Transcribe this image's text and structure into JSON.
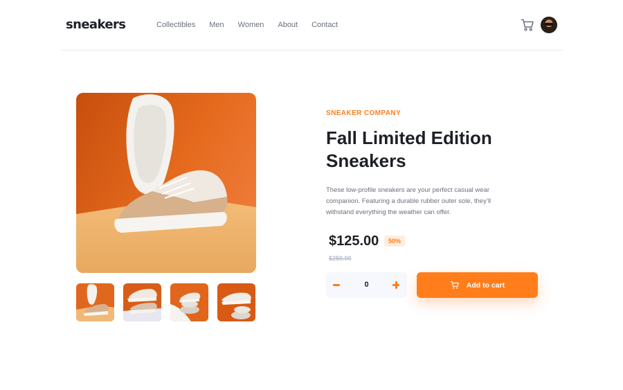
{
  "brand": {
    "logo": "sneakers"
  },
  "nav": {
    "items": [
      {
        "label": "Collectibles"
      },
      {
        "label": "Men"
      },
      {
        "label": "Women"
      },
      {
        "label": "About"
      },
      {
        "label": "Contact"
      }
    ]
  },
  "header": {
    "cart_icon": "cart-icon",
    "avatar": "user-avatar"
  },
  "gallery": {
    "main_image": "sneaker-main-photo",
    "thumbnails": [
      {
        "name": "thumbnail-1"
      },
      {
        "name": "thumbnail-2"
      },
      {
        "name": "thumbnail-3"
      },
      {
        "name": "thumbnail-4"
      }
    ]
  },
  "product": {
    "company": "SNEAKER COMPANY",
    "title": "Fall Limited Edition Sneakers",
    "description": "These low-profile sneakers are your perfect casual wear companion. Featuring a durable rubber outer sole, they’ll withstand everything the weather can offer.",
    "price": "$125.00",
    "discount": "50%",
    "original_price": "$250.00"
  },
  "cart_controls": {
    "quantity": "0",
    "minus_icon": "minus-icon",
    "plus_icon": "plus-icon",
    "add_label": "Add to cart"
  },
  "colors": {
    "accent": "#ff7e1b",
    "accent_pale": "#ffede0",
    "dark": "#1d2026",
    "muted": "#69707d",
    "light_bg": "#f6f8fd"
  }
}
